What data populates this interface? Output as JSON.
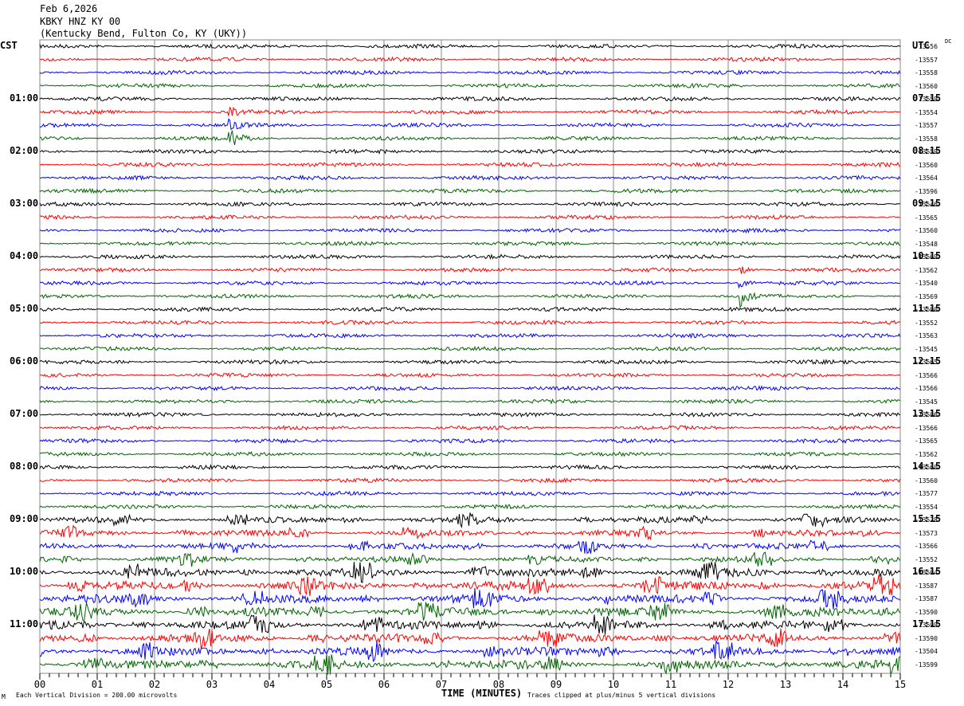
{
  "header": {
    "date": "Feb 6,2026",
    "station": "KBKY HNZ KY 00",
    "location": "(Kentucky Bend, Fulton Co, KY (UKY))"
  },
  "left_axis": {
    "label": "CST",
    "times": [
      "01:00",
      "02:00",
      "03:00",
      "04:00",
      "05:00",
      "06:00",
      "07:00",
      "08:00",
      "09:00",
      "10:00",
      "11:00"
    ]
  },
  "right_axis": {
    "label": "UTC",
    "dc_label": "DC",
    "times": [
      "07:15",
      "08:15",
      "09:15",
      "10:15",
      "11:15",
      "12:15",
      "13:15",
      "14:15",
      "15:15",
      "16:15",
      "17:15"
    ],
    "dc_offsets": [
      "-13556",
      "-13557",
      "-13558",
      "-13560",
      "-13559",
      "-13554",
      "-13557",
      "-13558",
      "-13559",
      "-13560",
      "-13564",
      "-13596",
      "-13546",
      "-13565",
      "-13560",
      "-13548",
      "-13569",
      "-13562",
      "-13540",
      "-13569",
      "-13500",
      "-13552",
      "-13563",
      "-13545",
      "-13565",
      "-13566",
      "-13566",
      "-13545",
      "-13506",
      "-13566",
      "-13565",
      "-13562",
      "-13560",
      "-13560",
      "-13577",
      "-13554",
      "-13528",
      "-13573",
      "-13566",
      "-13552",
      "-13504",
      "-13587",
      "-13587",
      "-13590",
      "-13599",
      "-13590",
      "-13504",
      "-13599"
    ]
  },
  "footer": {
    "scale": "Each Vertical Division =  200.00 microvolts",
    "xlabel": "TIME (MINUTES)",
    "clip_note": "Traces clipped at plus/minus 5 vertical divisions",
    "corner": "M"
  },
  "chart_data": {
    "type": "line",
    "title": "KBKY HNZ KY 00",
    "xlabel": "TIME (MINUTES)",
    "xlim": [
      0,
      15
    ],
    "x_ticks": [
      "00",
      "01",
      "02",
      "03",
      "04",
      "05",
      "06",
      "07",
      "08",
      "09",
      "10",
      "11",
      "12",
      "13",
      "14",
      "15"
    ],
    "trace_colors": [
      "#000000",
      "#ff0000",
      "#0000ff",
      "#006400"
    ],
    "trace_count": 48,
    "minutes_per_trace": 15,
    "grid": true,
    "events": [
      {
        "trace": 5,
        "minute": 3.3
      },
      {
        "trace": 17,
        "minute": 12.2
      }
    ]
  }
}
